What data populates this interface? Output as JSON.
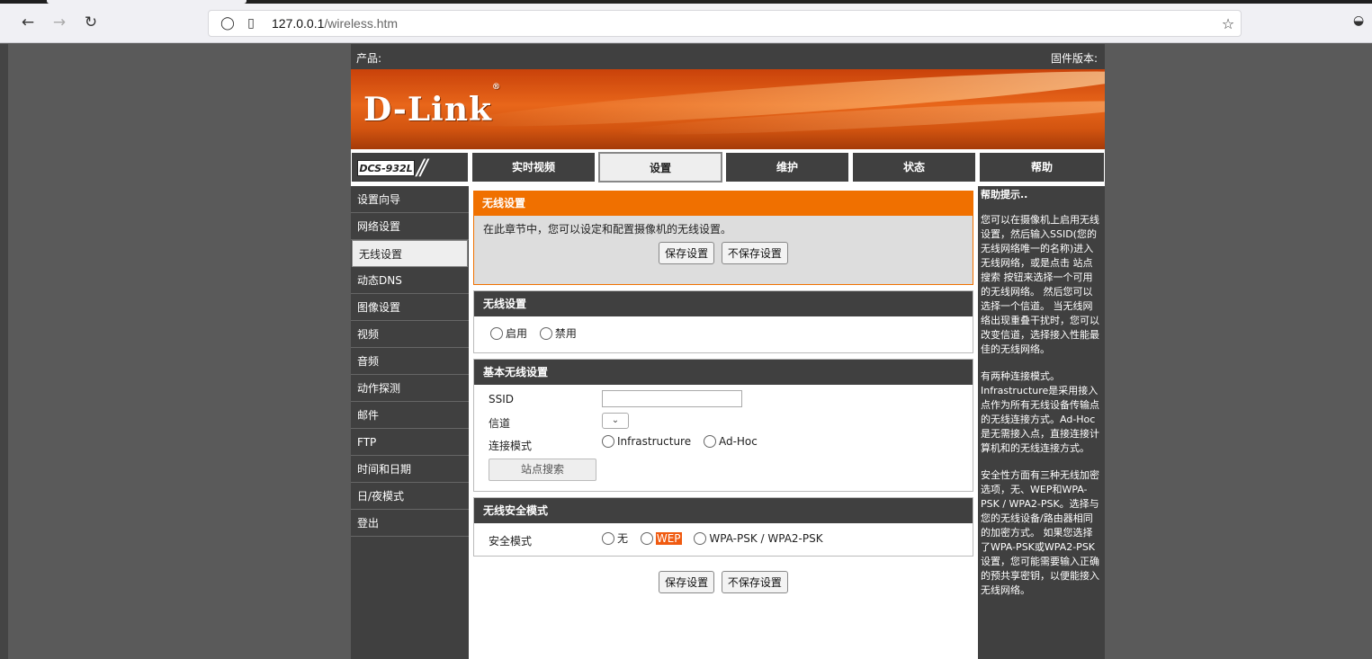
{
  "browser": {
    "url_host": "127.0.0.1",
    "url_path": "/wireless.htm"
  },
  "header": {
    "product_label": "产品:",
    "firmware_label": "固件版本:",
    "logo": "D-Link",
    "model": "DCS-932L"
  },
  "tabs": [
    "实时视频",
    "设置",
    "维护",
    "状态",
    "帮助"
  ],
  "active_tab": "设置",
  "sidebar": {
    "items": [
      "设置向导",
      "网络设置",
      "无线设置",
      "动态DNS",
      "图像设置",
      "视频",
      "音频",
      "动作探测",
      "邮件",
      "FTP",
      "时间和日期",
      "日/夜模式",
      "登出"
    ],
    "active": "无线设置"
  },
  "intro": {
    "title": "无线设置",
    "description": "在此章节中，您可以设定和配置摄像机的无线设置。",
    "save": "保存设置",
    "nosave": "不保存设置"
  },
  "wireless": {
    "title": "无线设置",
    "enable": "启用",
    "disable": "禁用"
  },
  "basic": {
    "title": "基本无线设置",
    "ssid_label": "SSID",
    "ssid_value": "",
    "channel_label": "信道",
    "mode_label": "连接模式",
    "mode_infra": "Infrastructure",
    "mode_adhoc": "Ad-Hoc",
    "survey_button": "站点搜索"
  },
  "security": {
    "title": "无线安全模式",
    "label": "安全模式",
    "none": "无",
    "wep": "WEP",
    "wpa": "WPA-PSK / WPA2-PSK"
  },
  "bottom": {
    "save": "保存设置",
    "nosave": "不保存设置"
  },
  "help": {
    "title": "帮助提示..",
    "p1": "您可以在摄像机上启用无线设置，然后输入SSID(您的无线网络唯一的名称)进入无线网络，或是点击 站点搜索 按钮来选择一个可用的无线网络。 然后您可以选择一个信道。 当无线网络出现重叠干扰时，您可以改变信道，选择接入性能最佳的无线网络。",
    "p2": "有两种连接模式。Infrastructure是采用接入点作为所有无线设备传输点的无线连接方式。Ad-Hoc是无需接入点，直接连接计算机和的无线连接方式。",
    "p3": "安全性方面有三种无线加密选项，无、WEP和WPA-PSK / WPA2-PSK。选择与您的无线设备/路由器相同的加密方式。 如果您选择了WPA-PSK或WPA2-PSK设置，您可能需要输入正确的预共享密钥，以便能接入无线网络。"
  }
}
